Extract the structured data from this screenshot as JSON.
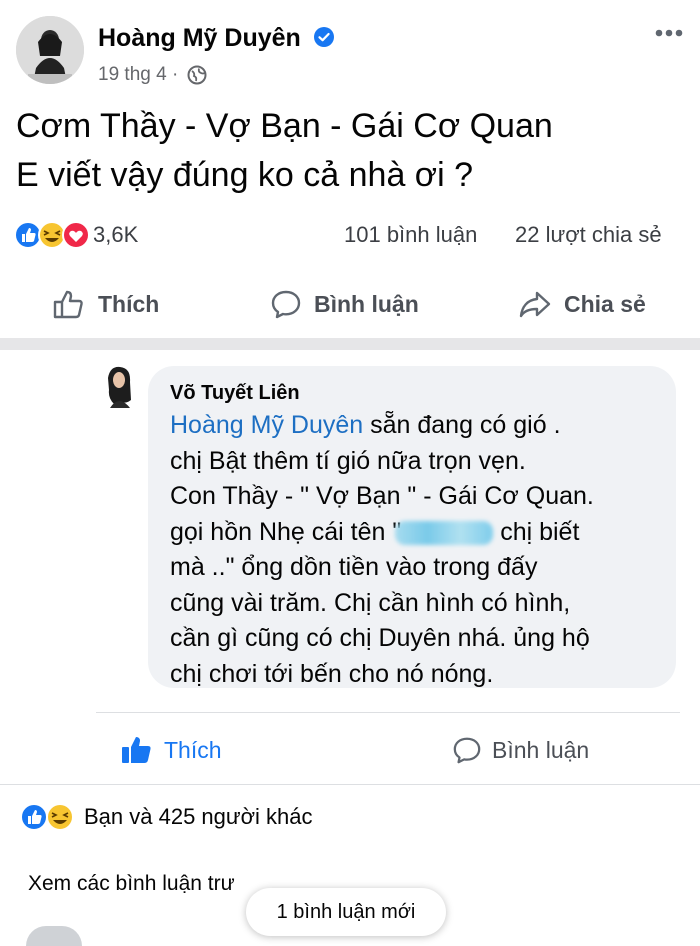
{
  "post": {
    "author": "Hoàng Mỹ Duyên",
    "date": "19 thg 4 ·",
    "text_lines": [
      "Cơm Thầy - Vợ Bạn - Gái Cơ Quan",
      "E viết vậy đúng ko cả nhà ơi ?"
    ],
    "reaction_count": "3,6K",
    "comment_count": "101 bình luận",
    "share_count": "22 lượt chia sẻ",
    "actions": {
      "like": "Thích",
      "comment": "Bình luận",
      "share": "Chia sẻ"
    }
  },
  "comment": {
    "author": "Võ Tuyết Liên",
    "mention": "Hoàng Mỹ Duyên",
    "line1_rest": " sẵn đang có gió .",
    "line2": "chị Bật thêm tí gió nữa trọn vẹn.",
    "line3": "Con Thầy - \" Vợ Bạn \" - Gái Cơ Quan.",
    "line4_a": "gọi hồn Nhẹ cái tên \"",
    "line4_b": " chị biết",
    "line5_a": "mà ..\" ổng dồn tiền vào trong đấy",
    "line6": "cũng vài trăm. Chị cần hình có hình,",
    "line7": "cần gì cũng có chị Duyên nhá. ủng hộ",
    "line8": "chị chơi tới bến cho nó nóng.",
    "actions": {
      "like": "Thích",
      "comment": "Bình luận"
    }
  },
  "footer": {
    "reactors": "Bạn và 425 người khác",
    "view_previous": "Xem các bình luận trư",
    "new_comment": "1 bình luận mới"
  },
  "colors": {
    "accent": "#1877f2",
    "mention": "#1d6fc3",
    "bubble": "#f0f2f5"
  }
}
